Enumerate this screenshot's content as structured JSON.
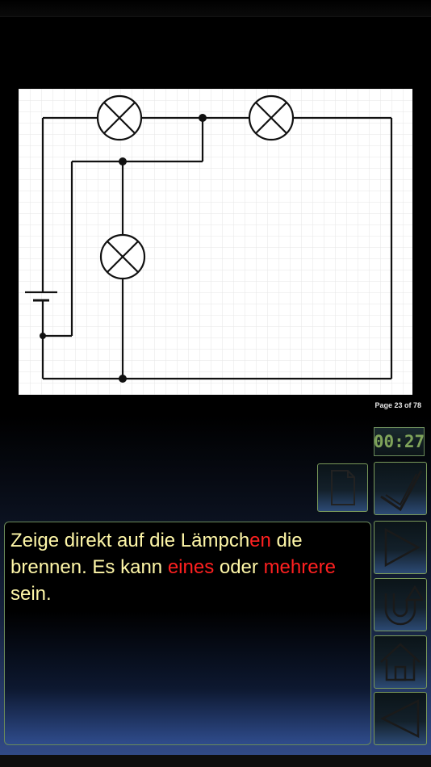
{
  "page_indicator": "Page 23 of 78",
  "timer": "00:27",
  "instruction": {
    "part1": "Zeige direkt auf die Lämpch",
    "part2": "en",
    "part3": " die brennen. Es kann ",
    "part4": "eines",
    "part5": " oder ",
    "part6": "mehrere",
    "part7": " sein."
  },
  "colors": {
    "instruction_text": "#fff7a8",
    "highlight": "#ff2020",
    "button_border": "#7a9a5a",
    "timer_text": "#7fa35a"
  },
  "buttons": [
    {
      "name": "document-button",
      "icon": "document-icon"
    },
    {
      "name": "check-button",
      "icon": "checkmark-icon"
    },
    {
      "name": "play-button",
      "icon": "play-icon"
    },
    {
      "name": "undo-button",
      "icon": "u-turn-icon"
    },
    {
      "name": "home-button",
      "icon": "home-icon"
    },
    {
      "name": "back-button",
      "icon": "back-arrow-icon"
    }
  ],
  "circuit": {
    "components": [
      "lamp",
      "lamp",
      "lamp",
      "battery"
    ],
    "junctions": 3
  }
}
